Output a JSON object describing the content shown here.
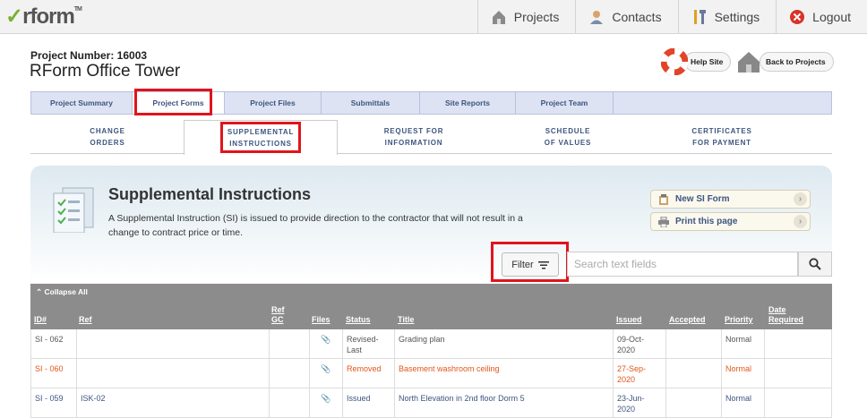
{
  "logo": "rform",
  "topnav": {
    "projects": "Projects",
    "contacts": "Contacts",
    "settings": "Settings",
    "logout": "Logout"
  },
  "header": {
    "project_number": "Project Number: 16003",
    "project_name": "RForm Office Tower",
    "help_site": "Help Site",
    "back_to_projects": "Back to Projects"
  },
  "tabs": [
    "Project Summary",
    "Project Forms",
    "Project Files",
    "Submittals",
    "Site Reports",
    "Project Team"
  ],
  "subtabs": [
    {
      "line1": "CHANGE",
      "line2": "ORDERS"
    },
    {
      "line1": "SUPPLEMENTAL",
      "line2": "INSTRUCTIONS"
    },
    {
      "line1": "REQUEST FOR",
      "line2": "INFORMATION"
    },
    {
      "line1": "SCHEDULE",
      "line2": "OF VALUES"
    },
    {
      "line1": "CERTIFICATES",
      "line2": "FOR PAYMENT"
    }
  ],
  "section": {
    "title": "Supplemental Instructions",
    "description": "A Supplemental Instruction (SI) is issued to provide direction to the contractor that will not result in a change to contract price or time.",
    "new_si": "New SI Form",
    "print": "Print this page"
  },
  "filter_label": "Filter",
  "search": {
    "placeholder": "Search text fields"
  },
  "table": {
    "collapse_all": "Collapse All",
    "columns": {
      "id": "ID#",
      "ref": "Ref",
      "ref_gc_1": "Ref",
      "ref_gc_2": "GC",
      "files": "Files",
      "status": "Status",
      "title": "Title",
      "issued": "Issued",
      "accepted": "Accepted",
      "priority": "Priority",
      "date_req_1": "Date",
      "date_req_2": "Required"
    },
    "rows": [
      {
        "id": "SI - 062",
        "ref": "",
        "status1": "Revised-",
        "status2": "Last",
        "title": "Grading plan",
        "issued1": "09-Oct-2020",
        "issued2": "",
        "priority": "Normal"
      },
      {
        "id": "SI - 060",
        "ref": "",
        "status1": "Removed",
        "status2": "",
        "title": "Basement washroom ceiling",
        "issued1": "27-Sep-",
        "issued2": "2020",
        "priority": "Normal"
      },
      {
        "id": "SI - 059",
        "ref": "ISK-02",
        "status1": "Issued",
        "status2": "",
        "title": "North Elevation in 2nd floor Dorm 5",
        "issued1": "23-Jun-",
        "issued2": "2020",
        "priority": "Normal"
      }
    ]
  },
  "colors": {
    "highlight": "#e0141c",
    "tab_bg": "#dde3f2",
    "link": "#3d5580",
    "removed": "#e2561a",
    "table_header": "#8c8c8c"
  }
}
